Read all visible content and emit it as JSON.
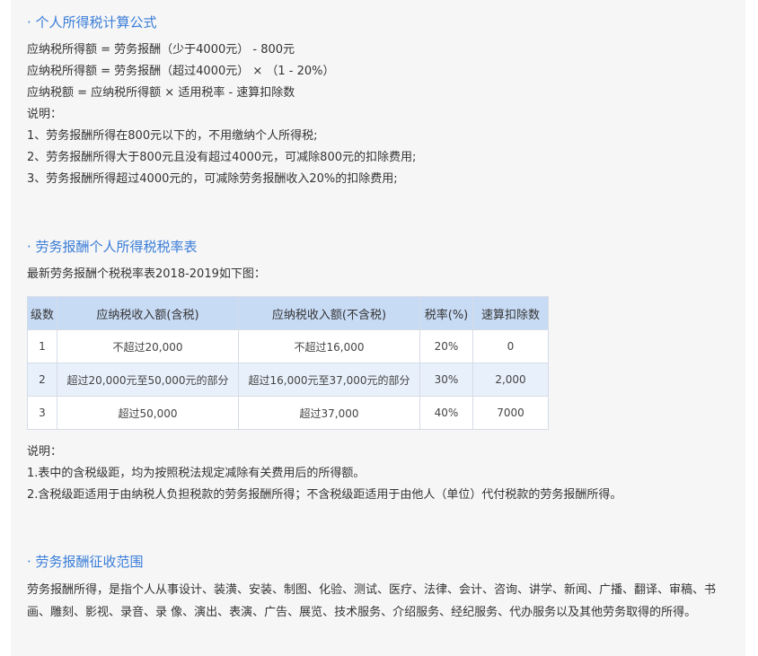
{
  "section1": {
    "title": "· 个人所得税计算公式",
    "lines": [
      "应纳税所得额 = 劳务报酬（少于4000元） - 800元",
      "应纳税所得额 = 劳务报酬（超过4000元）  ×  （1 - 20%）",
      "应纳税额 = 应纳税所得额 × 适用税率 - 速算扣除数",
      "说明：",
      "1、劳务报酬所得在800元以下的，不用缴纳个人所得税;",
      "2、劳务报酬所得大于800元且没有超过4000元，可减除800元的扣除费用;",
      "3、劳务报酬所得超过4000元的，可减除劳务报酬收入20%的扣除费用;"
    ]
  },
  "section2": {
    "title": "· 劳务报酬个人所得税税率表",
    "intro": "最新劳务报酬个税税率表2018-2019如下图：",
    "table": {
      "headers": [
        "级数",
        "应纳税收入额(含税)",
        "应纳税收入额(不含税)",
        "税率(%)",
        "速算扣除数"
      ],
      "rows": [
        [
          "1",
          "不超过20,000",
          "不超过16,000",
          "20%",
          "0"
        ],
        [
          "2",
          "超过20,000元至50,000元的部分",
          "超过16,000元至37,000元的部分",
          "30%",
          "2,000"
        ],
        [
          "3",
          "超过50,000",
          "超过37,000",
          "40%",
          "7000"
        ]
      ]
    },
    "notes": [
      "说明：",
      "1.表中的含税级距，均为按照税法规定减除有关费用后的所得额。",
      "2.含税级距适用于由纳税人负担税款的劳务报酬所得；不含税级距适用于由他人（单位）代付税款的劳务报酬所得。"
    ]
  },
  "section3": {
    "title": "· 劳务报酬征收范围",
    "text": "劳务报酬所得，是指个人从事设计、装潢、安装、制图、化验、测试、医疗、法律、会计、咨询、讲学、新闻、广播、翻译、审稿、书画、雕刻、影视、录音、录 像、演出、表演、广告、展览、技术服务、介绍服务、经纪服务、代办服务以及其他劳务取得的所得。"
  }
}
